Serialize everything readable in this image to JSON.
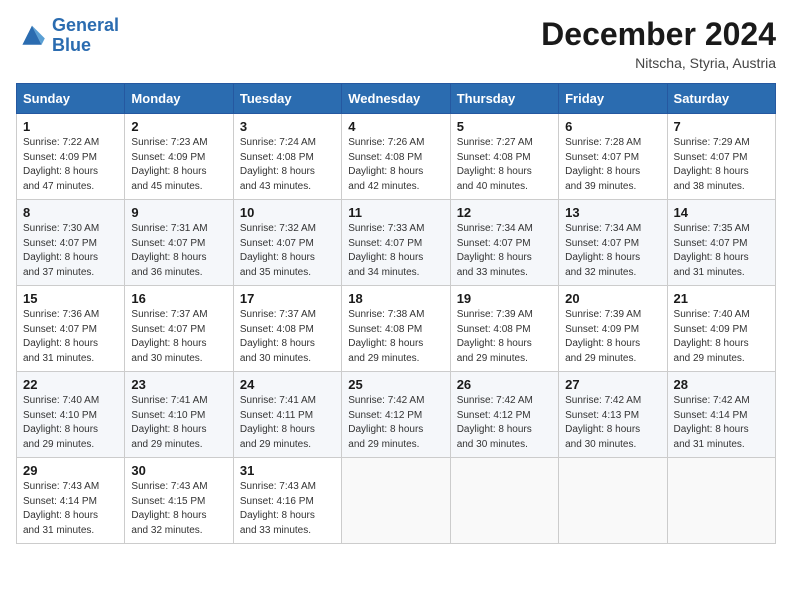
{
  "logo": {
    "line1": "General",
    "line2": "Blue"
  },
  "title": "December 2024",
  "location": "Nitscha, Styria, Austria",
  "days_of_week": [
    "Sunday",
    "Monday",
    "Tuesday",
    "Wednesday",
    "Thursday",
    "Friday",
    "Saturday"
  ],
  "weeks": [
    [
      {
        "day": "1",
        "info": "Sunrise: 7:22 AM\nSunset: 4:09 PM\nDaylight: 8 hours\nand 47 minutes."
      },
      {
        "day": "2",
        "info": "Sunrise: 7:23 AM\nSunset: 4:09 PM\nDaylight: 8 hours\nand 45 minutes."
      },
      {
        "day": "3",
        "info": "Sunrise: 7:24 AM\nSunset: 4:08 PM\nDaylight: 8 hours\nand 43 minutes."
      },
      {
        "day": "4",
        "info": "Sunrise: 7:26 AM\nSunset: 4:08 PM\nDaylight: 8 hours\nand 42 minutes."
      },
      {
        "day": "5",
        "info": "Sunrise: 7:27 AM\nSunset: 4:08 PM\nDaylight: 8 hours\nand 40 minutes."
      },
      {
        "day": "6",
        "info": "Sunrise: 7:28 AM\nSunset: 4:07 PM\nDaylight: 8 hours\nand 39 minutes."
      },
      {
        "day": "7",
        "info": "Sunrise: 7:29 AM\nSunset: 4:07 PM\nDaylight: 8 hours\nand 38 minutes."
      }
    ],
    [
      {
        "day": "8",
        "info": "Sunrise: 7:30 AM\nSunset: 4:07 PM\nDaylight: 8 hours\nand 37 minutes."
      },
      {
        "day": "9",
        "info": "Sunrise: 7:31 AM\nSunset: 4:07 PM\nDaylight: 8 hours\nand 36 minutes."
      },
      {
        "day": "10",
        "info": "Sunrise: 7:32 AM\nSunset: 4:07 PM\nDaylight: 8 hours\nand 35 minutes."
      },
      {
        "day": "11",
        "info": "Sunrise: 7:33 AM\nSunset: 4:07 PM\nDaylight: 8 hours\nand 34 minutes."
      },
      {
        "day": "12",
        "info": "Sunrise: 7:34 AM\nSunset: 4:07 PM\nDaylight: 8 hours\nand 33 minutes."
      },
      {
        "day": "13",
        "info": "Sunrise: 7:34 AM\nSunset: 4:07 PM\nDaylight: 8 hours\nand 32 minutes."
      },
      {
        "day": "14",
        "info": "Sunrise: 7:35 AM\nSunset: 4:07 PM\nDaylight: 8 hours\nand 31 minutes."
      }
    ],
    [
      {
        "day": "15",
        "info": "Sunrise: 7:36 AM\nSunset: 4:07 PM\nDaylight: 8 hours\nand 31 minutes."
      },
      {
        "day": "16",
        "info": "Sunrise: 7:37 AM\nSunset: 4:07 PM\nDaylight: 8 hours\nand 30 minutes."
      },
      {
        "day": "17",
        "info": "Sunrise: 7:37 AM\nSunset: 4:08 PM\nDaylight: 8 hours\nand 30 minutes."
      },
      {
        "day": "18",
        "info": "Sunrise: 7:38 AM\nSunset: 4:08 PM\nDaylight: 8 hours\nand 29 minutes."
      },
      {
        "day": "19",
        "info": "Sunrise: 7:39 AM\nSunset: 4:08 PM\nDaylight: 8 hours\nand 29 minutes."
      },
      {
        "day": "20",
        "info": "Sunrise: 7:39 AM\nSunset: 4:09 PM\nDaylight: 8 hours\nand 29 minutes."
      },
      {
        "day": "21",
        "info": "Sunrise: 7:40 AM\nSunset: 4:09 PM\nDaylight: 8 hours\nand 29 minutes."
      }
    ],
    [
      {
        "day": "22",
        "info": "Sunrise: 7:40 AM\nSunset: 4:10 PM\nDaylight: 8 hours\nand 29 minutes."
      },
      {
        "day": "23",
        "info": "Sunrise: 7:41 AM\nSunset: 4:10 PM\nDaylight: 8 hours\nand 29 minutes."
      },
      {
        "day": "24",
        "info": "Sunrise: 7:41 AM\nSunset: 4:11 PM\nDaylight: 8 hours\nand 29 minutes."
      },
      {
        "day": "25",
        "info": "Sunrise: 7:42 AM\nSunset: 4:12 PM\nDaylight: 8 hours\nand 29 minutes."
      },
      {
        "day": "26",
        "info": "Sunrise: 7:42 AM\nSunset: 4:12 PM\nDaylight: 8 hours\nand 30 minutes."
      },
      {
        "day": "27",
        "info": "Sunrise: 7:42 AM\nSunset: 4:13 PM\nDaylight: 8 hours\nand 30 minutes."
      },
      {
        "day": "28",
        "info": "Sunrise: 7:42 AM\nSunset: 4:14 PM\nDaylight: 8 hours\nand 31 minutes."
      }
    ],
    [
      {
        "day": "29",
        "info": "Sunrise: 7:43 AM\nSunset: 4:14 PM\nDaylight: 8 hours\nand 31 minutes."
      },
      {
        "day": "30",
        "info": "Sunrise: 7:43 AM\nSunset: 4:15 PM\nDaylight: 8 hours\nand 32 minutes."
      },
      {
        "day": "31",
        "info": "Sunrise: 7:43 AM\nSunset: 4:16 PM\nDaylight: 8 hours\nand 33 minutes."
      },
      {
        "day": "",
        "info": ""
      },
      {
        "day": "",
        "info": ""
      },
      {
        "day": "",
        "info": ""
      },
      {
        "day": "",
        "info": ""
      }
    ]
  ]
}
